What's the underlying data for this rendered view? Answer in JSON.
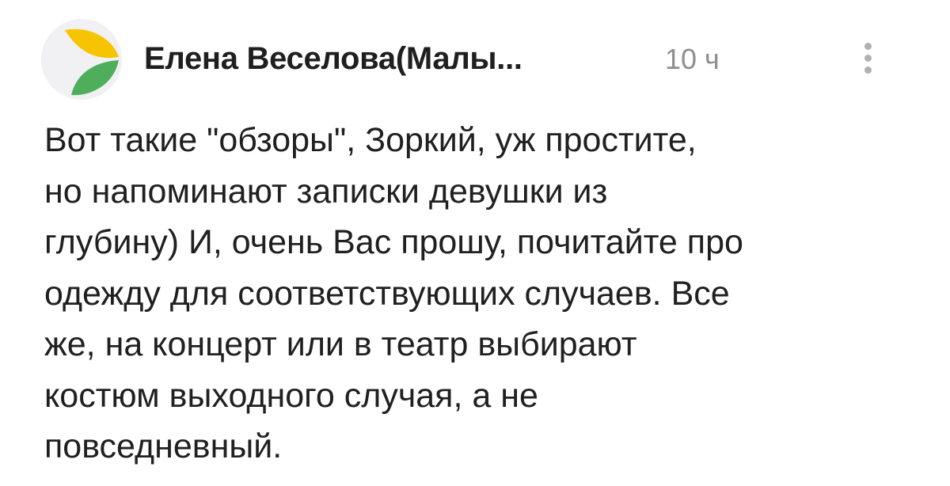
{
  "comment": {
    "author": "Елена Веселова(Малы...",
    "time": "10 ч",
    "text": "Вот такие \"обзоры\", Зоркий, уж простите,\nно напоминают записки девушки из\nглубину) И, очень Вас прошу, почитайте про\nодежду для соответствующих случаев. Все\nже, на концерт или в театр выбирают\nкостюм выходного случая, а не\nповседневный."
  },
  "avatar": {
    "icon": "leaf-logo-icon",
    "colors": {
      "yellow": "#f6c400",
      "green": "#4fae5c",
      "background": "#f1f1f3"
    }
  },
  "more_icon": "vertical-ellipsis-icon"
}
